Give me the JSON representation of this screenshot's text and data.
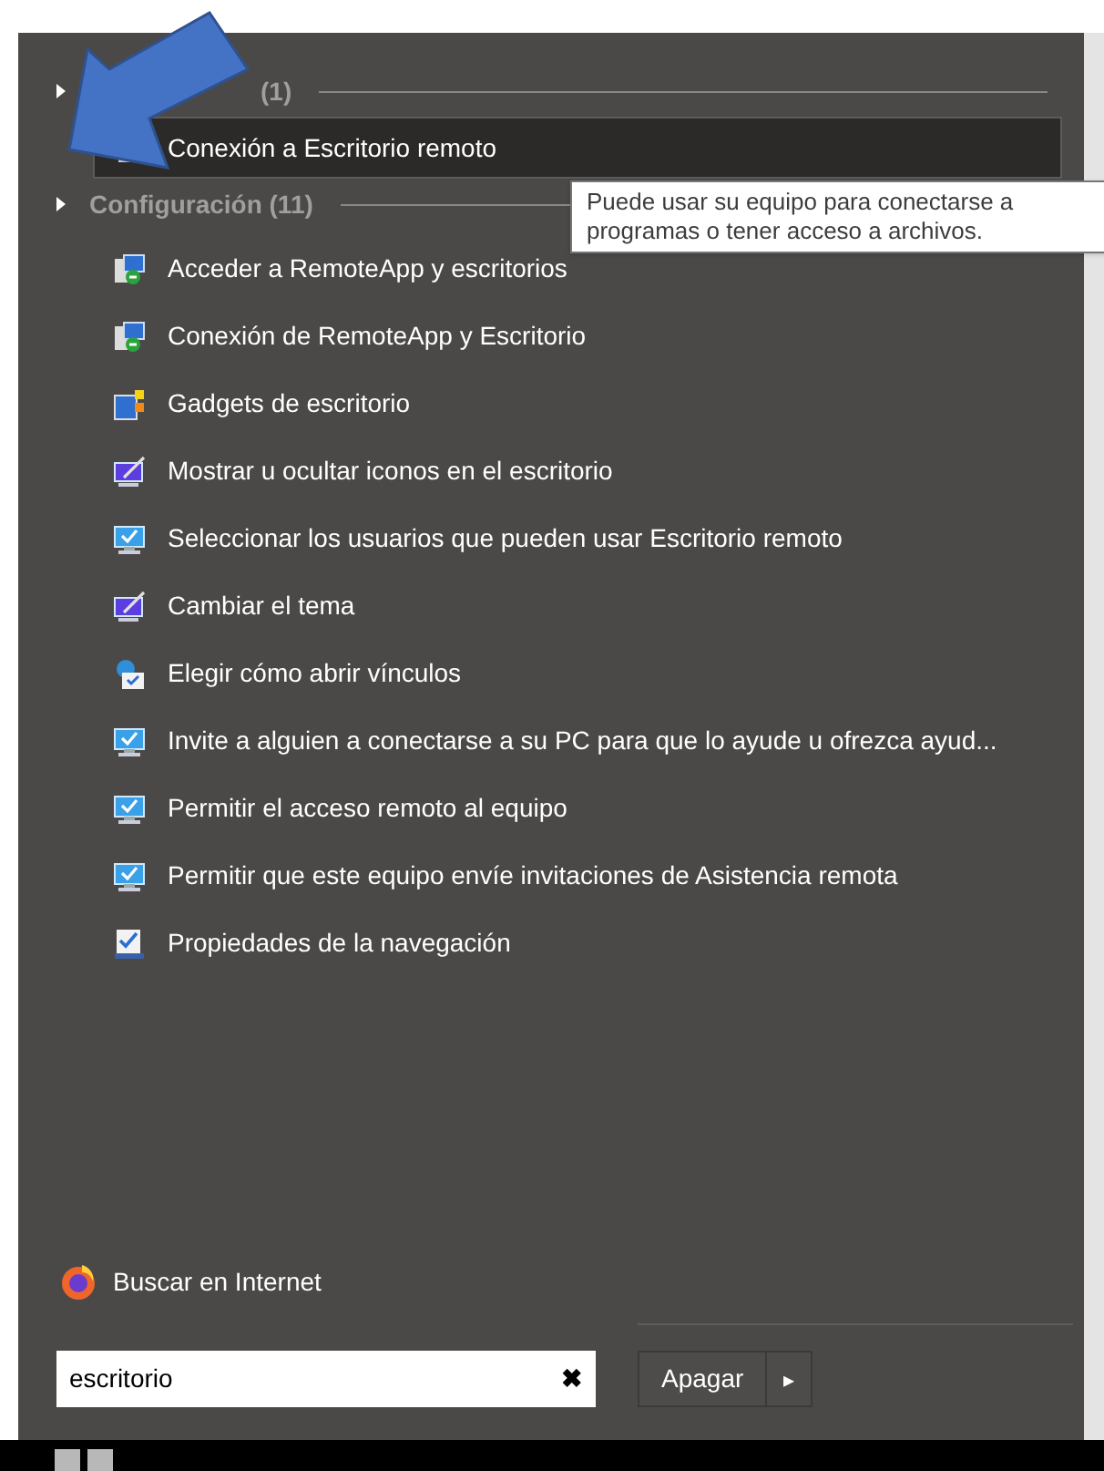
{
  "groups": [
    {
      "heading": "(1)",
      "items": [
        {
          "label": "Conexión a Escritorio remoto",
          "kind": "remote-desktop",
          "selected": true
        }
      ]
    },
    {
      "heading": "Configuración (11)",
      "items": [
        {
          "label": "Acceder a RemoteApp y escritorios",
          "kind": "remoteapp",
          "selected": false
        },
        {
          "label": "Conexión de RemoteApp y Escritorio",
          "kind": "remoteapp",
          "selected": false
        },
        {
          "label": "Gadgets de escritorio",
          "kind": "gadgets",
          "selected": false
        },
        {
          "label": "Mostrar u ocultar iconos en el escritorio",
          "kind": "display",
          "selected": false
        },
        {
          "label": "Seleccionar los usuarios que pueden usar Escritorio remoto",
          "kind": "monitor-check",
          "selected": false
        },
        {
          "label": "Cambiar el tema",
          "kind": "display",
          "selected": false
        },
        {
          "label": "Elegir cómo abrir vínculos",
          "kind": "globe-check",
          "selected": false
        },
        {
          "label": "Invite a alguien a conectarse a su PC para que lo ayude u ofrezca ayud...",
          "kind": "monitor-check",
          "selected": false
        },
        {
          "label": "Permitir el acceso remoto al equipo",
          "kind": "monitor-check",
          "selected": false
        },
        {
          "label": "Permitir que este equipo envíe invitaciones de Asistencia remota",
          "kind": "monitor-check",
          "selected": false
        },
        {
          "label": "Propiedades de la navegación",
          "kind": "checklist",
          "selected": false
        }
      ]
    }
  ],
  "tooltip": [
    "Puede usar su equipo para conectarse a",
    "programas o tener acceso a archivos."
  ],
  "web_search": "Buscar en Internet",
  "search": {
    "value": "escritorio",
    "clear": "✖"
  },
  "shutdown": {
    "label": "Apagar",
    "arrow": "▸"
  }
}
